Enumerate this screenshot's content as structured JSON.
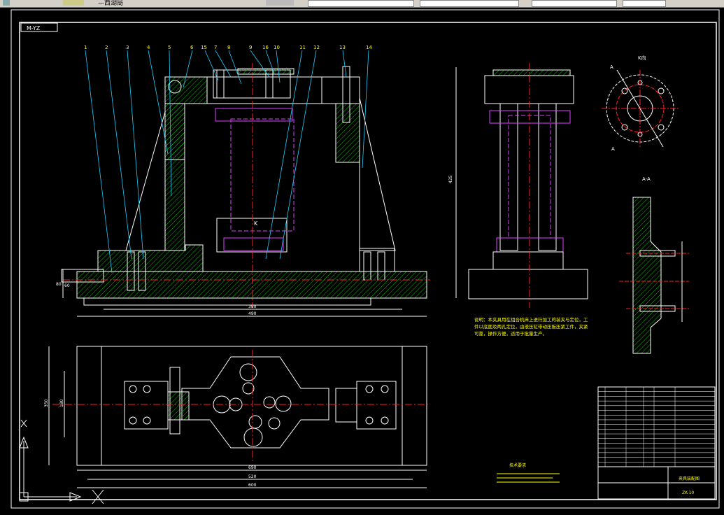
{
  "window": {
    "toolbar_label": "—西湖局"
  },
  "drawing": {
    "tag": "M-YZ",
    "balloons": [
      "1",
      "2",
      "3",
      "4",
      "5",
      "6",
      "15",
      "7",
      "8",
      "9",
      "16",
      "10",
      "11",
      "12",
      "13",
      "14"
    ],
    "view_label_k": "K向",
    "section_label_a": "A",
    "section_aa": "A-A",
    "dim_k": "K",
    "dim_total_front": "380",
    "dim_base_front": "490",
    "dim_height": "425",
    "dim_left": "80",
    "dim_left2": "60",
    "dim_plan_len1": "690",
    "dim_plan_len2": "520",
    "dim_plan_len3": "600",
    "dim_plan_w1": "350",
    "dim_plan_w2": "180",
    "tech_notes": "说明：本夹具用在组合机床上进行加工的装夹与定位，工件以底面及两孔定位，由液压缸带动压板压紧工件，夹紧可靠，操作方便，适用于批量生产。",
    "tech_req": "技术要求",
    "title_block_name": "夹具装配图",
    "title_block_code": "ZK-10",
    "bom_rows": 17
  },
  "colors": {
    "outline": "#ffffff",
    "hatch": "#00c000",
    "center": "#ff2020",
    "hidden": "#e040ff",
    "leader": "#20d0ff",
    "text": "#ffff00",
    "dim": "#00ff00"
  }
}
